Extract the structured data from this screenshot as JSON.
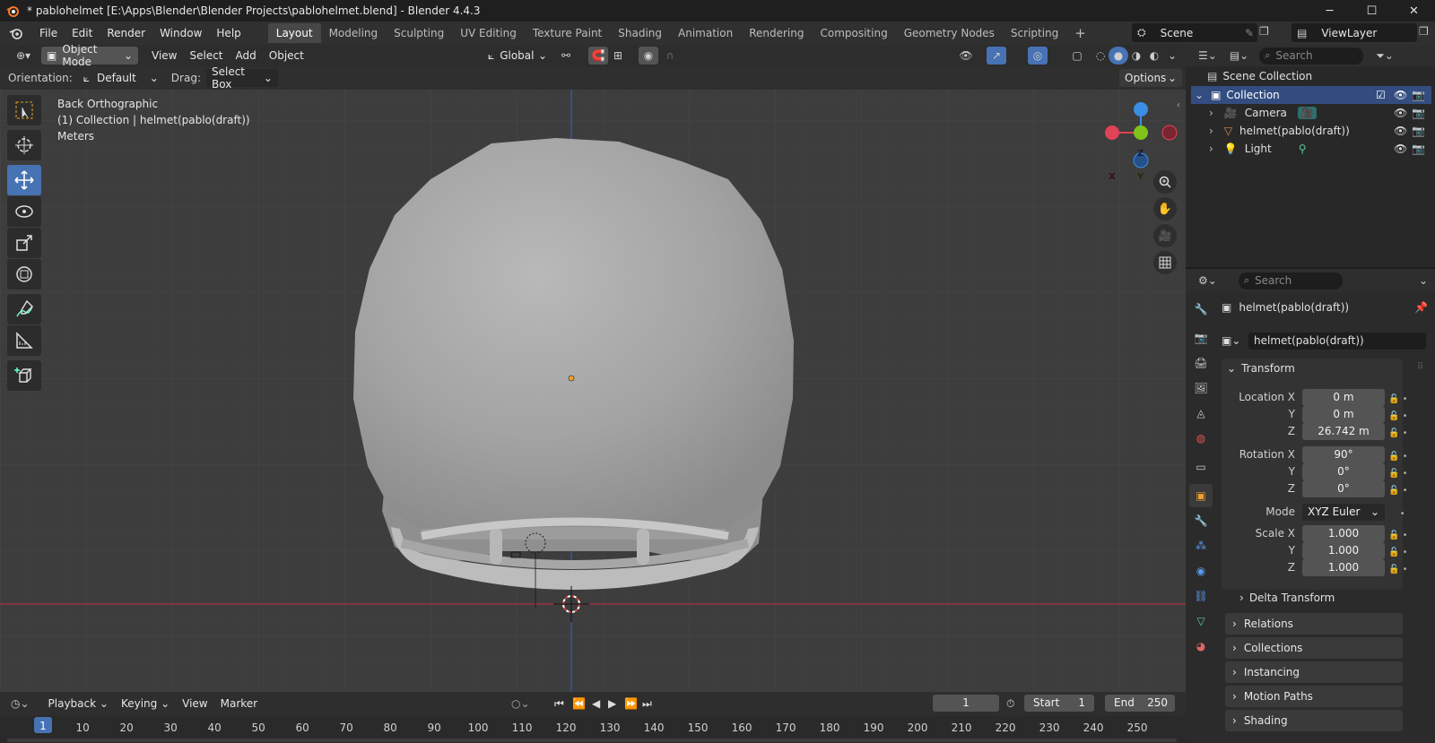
{
  "window": {
    "title": "* pablohelmet [E:\\Apps\\Blender\\Blender Projects\\pablohelmet.blend] - Blender 4.4.3",
    "controls": {
      "minimize": "─",
      "maximize": "☐",
      "close": "✕"
    }
  },
  "menu": [
    "File",
    "Edit",
    "Render",
    "Window",
    "Help"
  ],
  "workspaces": [
    "Layout",
    "Modeling",
    "Sculpting",
    "UV Editing",
    "Texture Paint",
    "Shading",
    "Animation",
    "Rendering",
    "Compositing",
    "Geometry Nodes",
    "Scripting"
  ],
  "active_workspace": "Layout",
  "add_workspace": "+",
  "scene": {
    "name": "Scene",
    "view_layer": "ViewLayer"
  },
  "viewport": {
    "mode": "Object Mode",
    "menus": [
      "View",
      "Select",
      "Add",
      "Object"
    ],
    "transform_orientation": "Global",
    "orientation_label": "Orientation:",
    "orientation_value": "Default",
    "drag_label": "Drag:",
    "drag_value": "Select Box",
    "options_label": "Options",
    "view_name": "Back Orthographic",
    "collection_info": "(1) Collection | helmet(pablo(draft))",
    "units": "Meters",
    "gizmo": {
      "x": "X",
      "y": "Y",
      "z": "Z"
    }
  },
  "outliner": {
    "search_placeholder": "Search",
    "root": "Scene Collection",
    "collection": "Collection",
    "items": [
      {
        "name": "Camera",
        "icon": "camera-icon"
      },
      {
        "name": "helmet(pablo(draft))",
        "icon": "mesh-icon"
      },
      {
        "name": "Light",
        "icon": "light-icon"
      }
    ]
  },
  "properties": {
    "search_placeholder": "Search",
    "object_name": "helmet(pablo(draft))",
    "datablock_name": "helmet(pablo(draft))",
    "transform_title": "Transform",
    "location": {
      "label": "Location X",
      "x": "0 m",
      "y": "0 m",
      "z": "26.742 m"
    },
    "rotation": {
      "label": "Rotation X",
      "x": "90°",
      "y": "0°",
      "z": "0°"
    },
    "mode_label": "Mode",
    "mode_value": "XYZ Euler",
    "scale": {
      "label": "Scale X",
      "x": "1.000",
      "y": "1.000",
      "z": "1.000"
    },
    "axis_y": "Y",
    "axis_z": "Z",
    "delta_transform": "Delta Transform",
    "panels": [
      "Relations",
      "Collections",
      "Instancing",
      "Motion Paths",
      "Shading"
    ]
  },
  "timeline": {
    "menus": [
      "Playback",
      "Keying",
      "View",
      "Marker"
    ],
    "current_frame": "1",
    "start_label": "Start",
    "start": "1",
    "end_label": "End",
    "end": "250",
    "ruler": [
      "1",
      "10",
      "20",
      "30",
      "40",
      "50",
      "60",
      "70",
      "80",
      "90",
      "100",
      "110",
      "120",
      "130",
      "140",
      "150",
      "160",
      "170",
      "180",
      "190",
      "200",
      "210",
      "220",
      "230",
      "240",
      "250"
    ]
  },
  "colors": {
    "accent": "#4772b3",
    "x_axis": "#e04257",
    "y_axis": "#7fc41a",
    "z_axis": "#3a8ee6",
    "origin": "#f0a030"
  }
}
